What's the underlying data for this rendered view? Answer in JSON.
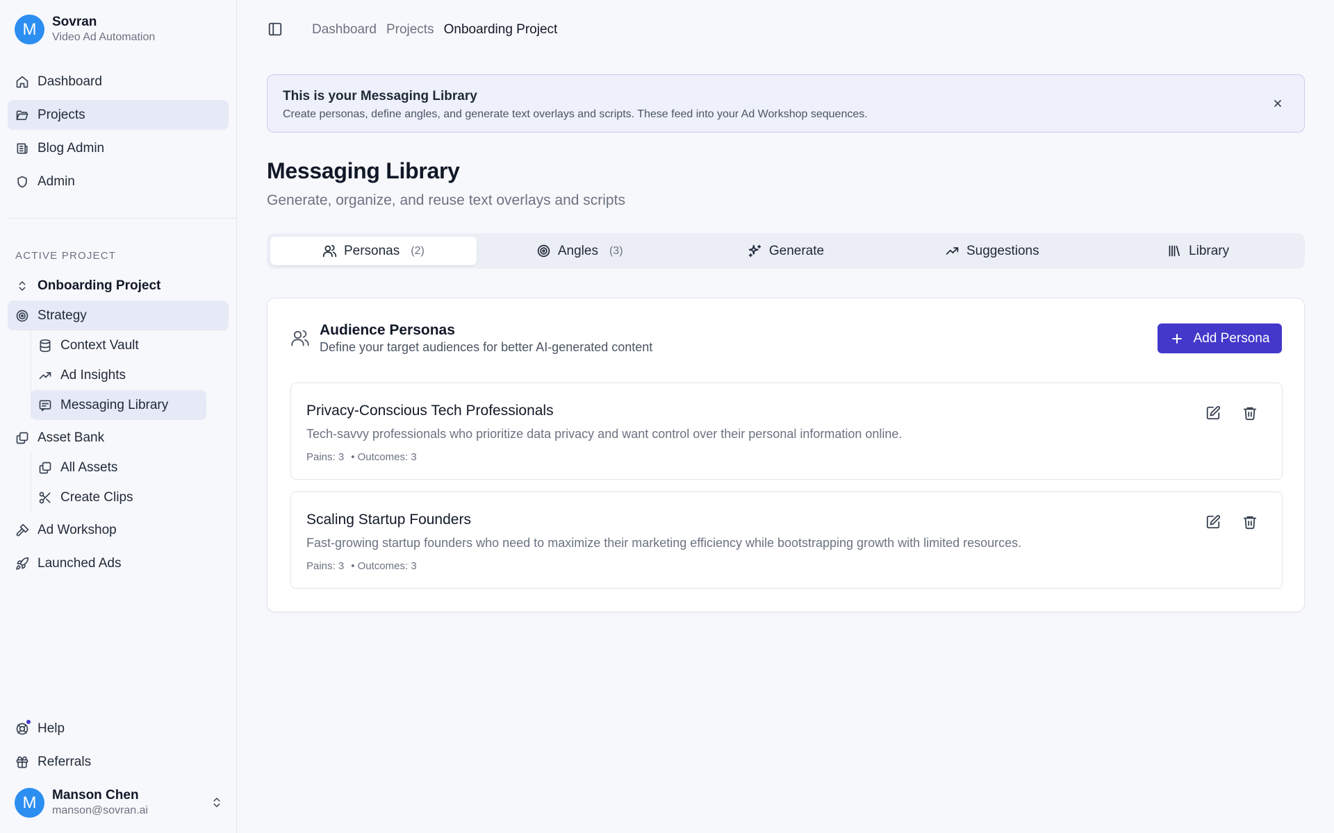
{
  "brand": {
    "initial": "M",
    "name": "Sovran",
    "subtitle": "Video Ad Automation"
  },
  "nav": {
    "items": [
      {
        "label": "Dashboard",
        "icon": "home-icon"
      },
      {
        "label": "Projects",
        "icon": "folder-open-icon",
        "active": true
      },
      {
        "label": "Blog Admin",
        "icon": "newspaper-icon"
      },
      {
        "label": "Admin",
        "icon": "shield-icon"
      }
    ]
  },
  "active_project": {
    "section_label": "ACTIVE PROJECT",
    "project_name": "Onboarding Project",
    "strategy": "Strategy",
    "strategy_children": [
      "Context Vault",
      "Ad Insights",
      "Messaging Library"
    ],
    "asset_bank": "Asset Bank",
    "asset_children": [
      "All Assets",
      "Create Clips"
    ],
    "ad_workshop": "Ad Workshop",
    "launched_ads": "Launched Ads"
  },
  "footer_nav": {
    "help": "Help",
    "referrals": "Referrals"
  },
  "user": {
    "initial": "M",
    "name": "Manson Chen",
    "email": "manson@sovran.ai"
  },
  "breadcrumb": [
    "Dashboard",
    "Projects",
    "Onboarding Project"
  ],
  "banner": {
    "title": "This is your Messaging Library",
    "text": "Create personas, define angles, and generate text overlays and scripts. These feed into your Ad Workshop sequences."
  },
  "page": {
    "title": "Messaging Library",
    "subtitle": "Generate, organize, and reuse text overlays and scripts"
  },
  "tabs": [
    {
      "label": "Personas",
      "count": "(2)",
      "icon": "users-icon",
      "active": true
    },
    {
      "label": "Angles",
      "count": "(3)",
      "icon": "target-icon"
    },
    {
      "label": "Generate",
      "count": "",
      "icon": "sparkles-icon"
    },
    {
      "label": "Suggestions",
      "count": "",
      "icon": "trending-up-icon"
    },
    {
      "label": "Library",
      "count": "",
      "icon": "library-icon"
    }
  ],
  "personas_card": {
    "title": "Audience Personas",
    "subtitle": "Define your target audiences for better AI-generated content",
    "add_label": "Add Persona",
    "items": [
      {
        "name": "Privacy-Conscious Tech Professionals",
        "description": "Tech-savvy professionals who prioritize data privacy and want control over their personal information online.",
        "pains": "Pains: 3",
        "outcomes": "• Outcomes: 3"
      },
      {
        "name": "Scaling Startup Founders",
        "description": "Fast-growing startup founders who need to maximize their marketing efficiency while bootstrapping growth with limited resources.",
        "pains": "Pains: 3",
        "outcomes": "• Outcomes: 3"
      }
    ]
  },
  "colors": {
    "accent": "#4338ca",
    "avatar": "#2b8ef0",
    "active_nav": "#e6eaf6",
    "banner_bg": "#eef0fb"
  }
}
